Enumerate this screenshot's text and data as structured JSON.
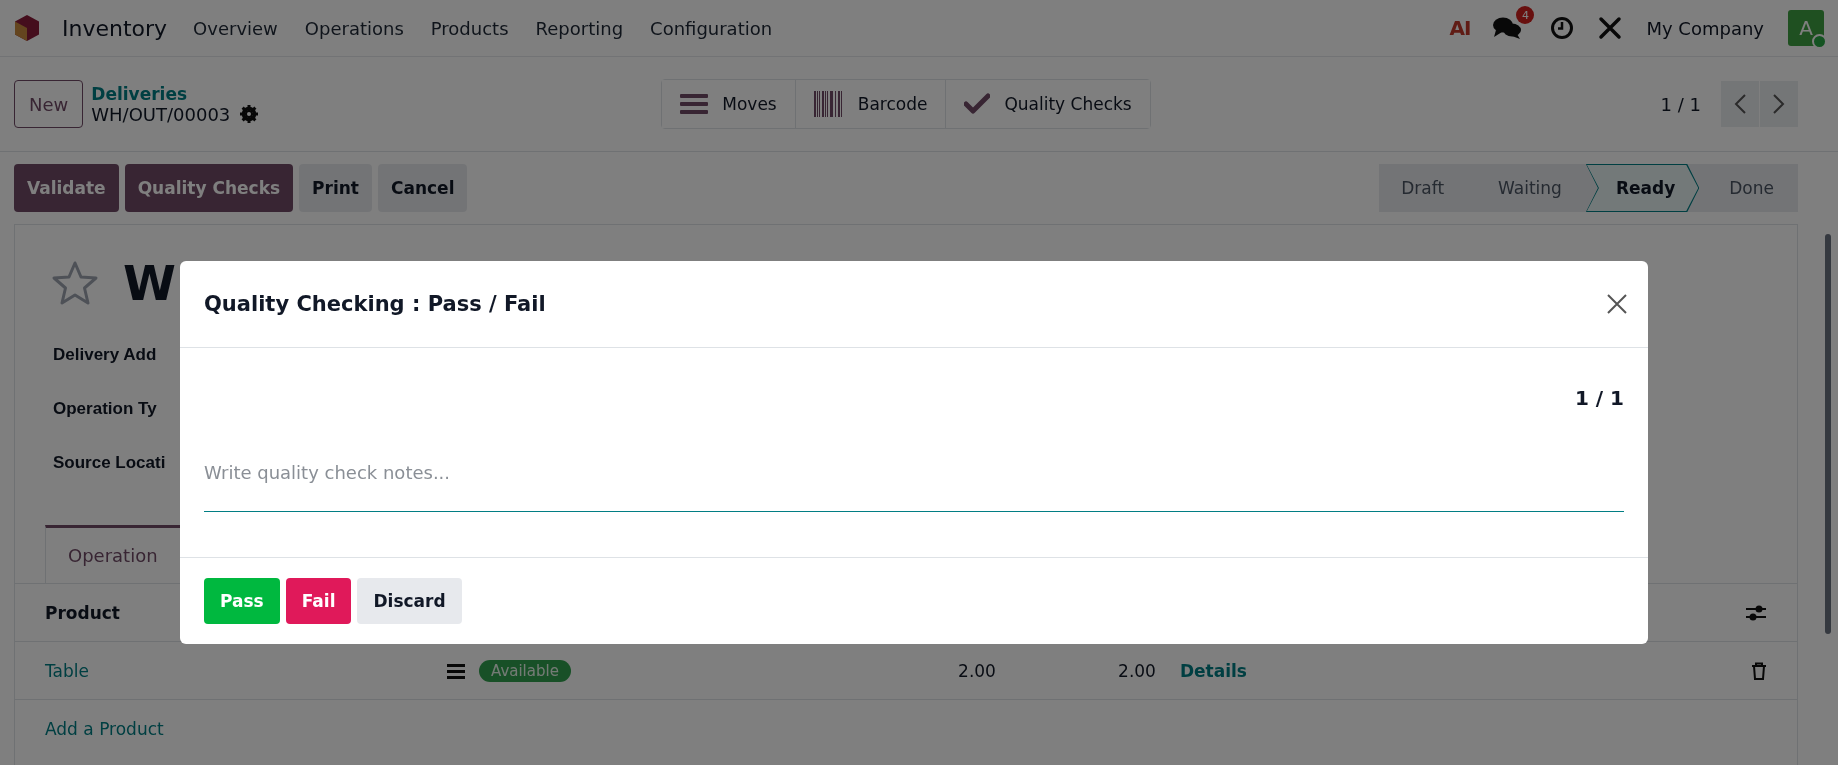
{
  "navbar": {
    "app_name": "Inventory",
    "menu": [
      "Overview",
      "Operations",
      "Products",
      "Reporting",
      "Configuration"
    ],
    "ai_label": "AI",
    "chat_count": "4",
    "company": "My Company",
    "avatar": "A"
  },
  "control_panel": {
    "new_button": "New",
    "breadcrumb": "Deliveries",
    "record": "WH/OUT/00003",
    "smart_buttons": [
      {
        "label": "Moves",
        "kind": "list"
      },
      {
        "label": "Barcode",
        "kind": "barcode"
      },
      {
        "label": "Quality Checks",
        "kind": "check"
      }
    ],
    "pager": "1 / 1"
  },
  "action_buttons": [
    {
      "label": "Validate",
      "kind": "primary"
    },
    {
      "label": "Quality Checks",
      "kind": "primary"
    },
    {
      "label": "Print",
      "kind": "secondary"
    },
    {
      "label": "Cancel",
      "kind": "secondary"
    }
  ],
  "statusbar": [
    {
      "label": "Draft",
      "selected": false
    },
    {
      "label": "Waiting",
      "selected": false
    },
    {
      "label": "Ready",
      "selected": true
    },
    {
      "label": "Done",
      "selected": false
    }
  ],
  "form": {
    "starred": false,
    "title": "W",
    "fields": [
      "Delivery Add",
      "Operation Ty",
      "Source Locati"
    ],
    "tabs": [
      {
        "label": "Operation",
        "selected": true
      }
    ],
    "table": {
      "columns": [
        "Product"
      ],
      "rows": [
        {
          "product": "Table",
          "status": "Available",
          "column_3": "2.00",
          "column_4": "2.00",
          "link": "Details"
        }
      ],
      "add_line": "Add a Product"
    }
  },
  "dialog": {
    "title": "Quality Checking : Pass / Fail",
    "counter": "1 / 1",
    "notes": {
      "placeholder": "Write quality check notes..."
    },
    "buttons": [
      {
        "label": "Pass",
        "kind": "pass"
      },
      {
        "label": "Fail",
        "kind": "fail"
      },
      {
        "label": "Discard",
        "kind": "discard"
      }
    ]
  }
}
